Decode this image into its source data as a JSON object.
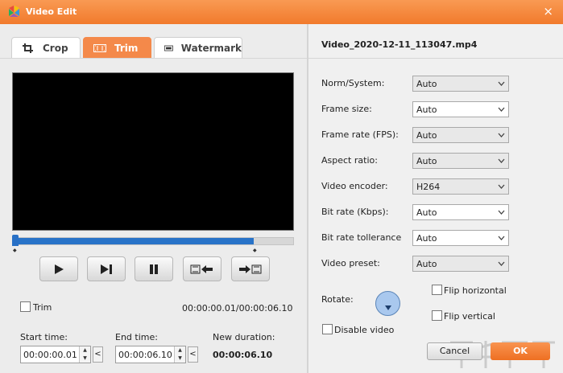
{
  "window": {
    "title": "Video Edit",
    "close_label": "×"
  },
  "tabs": [
    {
      "label": "Crop",
      "icon": "crop-icon",
      "active": false
    },
    {
      "label": "Trim",
      "icon": "film-strip-icon",
      "active": true
    },
    {
      "label": "Watermark",
      "icon": "watermark-icon",
      "active": false
    }
  ],
  "player": {
    "progress": 0.86,
    "controls": [
      "play-icon",
      "next-frame-icon",
      "pause-icon",
      "set-start-icon",
      "set-end-icon"
    ]
  },
  "trim": {
    "checkbox_label": "Trim",
    "checked": false,
    "range_readout": "00:00:00.01/00:00:06.10",
    "start_label": "Start time:",
    "start_value": "00:00:00.01",
    "end_label": "End time:",
    "end_value": "00:00:06.10",
    "duration_label": "New duration:",
    "duration_value": "00:00:06.10",
    "set_button": "<"
  },
  "settings": {
    "filename": "Video_2020-12-11_113047.mp4",
    "rows": [
      {
        "label": "Norm/System:",
        "value": "Auto",
        "enabled": false
      },
      {
        "label": "Frame size:",
        "value": "Auto",
        "enabled": true
      },
      {
        "label": "Frame rate (FPS):",
        "value": "Auto",
        "enabled": false
      },
      {
        "label": "Aspect ratio:",
        "value": "Auto",
        "enabled": false
      },
      {
        "label": "Video encoder:",
        "value": "H264",
        "enabled": false
      },
      {
        "label": "Bit rate (Kbps):",
        "value": "Auto",
        "enabled": true
      },
      {
        "label": "Bit rate tollerance",
        "value": "Auto",
        "enabled": true
      },
      {
        "label": "Video preset:",
        "value": "Auto",
        "enabled": false
      }
    ],
    "rotate_label": "Rotate:",
    "flip_horizontal_label": "Flip horizontal",
    "flip_vertical_label": "Flip vertical",
    "disable_video_label": "Disable video"
  },
  "buttons": {
    "cancel": "Cancel",
    "ok": "OK"
  },
  "colors": {
    "accent": "#f17a2c",
    "progress": "#2873c8"
  }
}
